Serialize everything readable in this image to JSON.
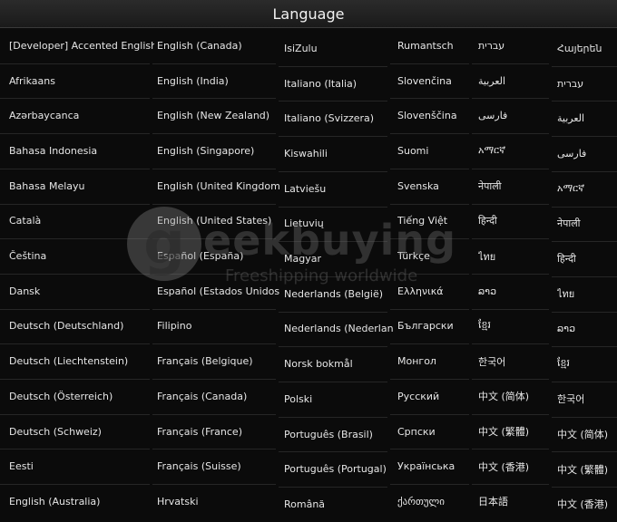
{
  "title": "Language",
  "watermark": {
    "logo_letter": "g",
    "brand": "eekbuying",
    "tagline": "Freeshipping worldwide"
  },
  "columns": [
    [
      "[Developer] Accented English",
      "Afrikaans",
      "Azərbaycanca",
      "Bahasa Indonesia",
      "Bahasa Melayu",
      "Català",
      "Čeština",
      "Dansk",
      "Deutsch (Deutschland)",
      "Deutsch (Liechtenstein)",
      "Deutsch (Österreich)",
      "Deutsch (Schweiz)",
      "Eesti",
      "English (Australia)"
    ],
    [
      "English (Canada)",
      "English (India)",
      "English (New Zealand)",
      "English (Singapore)",
      "English (United Kingdom)",
      "English (United States)",
      "Español (España)",
      "Español (Estados Unidos)",
      "Filipino",
      "Français (Belgique)",
      "Français (Canada)",
      "Français (France)",
      "Français (Suisse)",
      "Hrvatski"
    ],
    [
      "IsiZulu",
      "Italiano (Italia)",
      "Italiano (Svizzera)",
      "Kiswahili",
      "Latviešu",
      "Lietuvių",
      "Magyar",
      "Nederlands (België)",
      "Nederlands (Nederland)",
      "Norsk bokmål",
      "Polski",
      "Português (Brasil)",
      "Português (Portugal)",
      "Română"
    ],
    [
      "Rumantsch",
      "Slovenčina",
      "Slovenščina",
      "Suomi",
      "Svenska",
      "Tiếng Việt",
      "Türkçe",
      "Ελληνικά",
      "Български",
      "Монгол",
      "Русский",
      "Српски",
      "Українська",
      "ქართული"
    ],
    [
      "עברית",
      "العربية",
      "فارسی",
      "አማርኛ",
      "नेपाली",
      "हिन्दी",
      "ไทย",
      "ລາວ",
      "ខ្មែរ",
      "한국어",
      "中文 (简体)",
      "中文 (繁體)",
      "中文 (香港)",
      "日本語"
    ],
    [
      "Հայերեն",
      "עברית",
      "العربية",
      "فارسی",
      "አማርኛ",
      "नेपाली",
      "हिन्दी",
      "ไทย",
      "ລາວ",
      "ខ្មែរ",
      "한국어",
      "中文 (简体)",
      "中文 (繁體)",
      "中文 (香港)"
    ]
  ]
}
